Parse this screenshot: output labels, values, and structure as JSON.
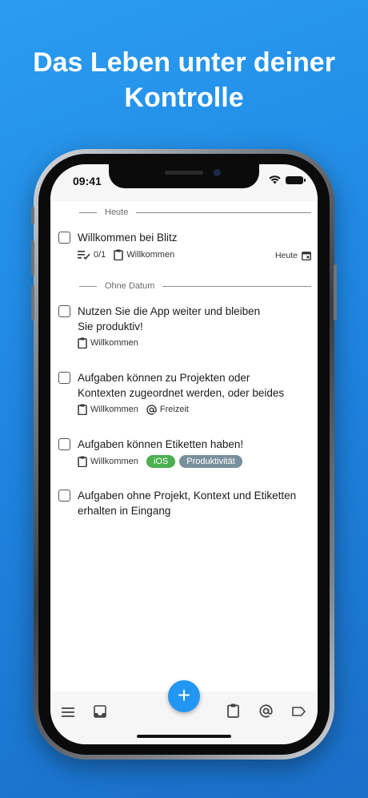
{
  "headline": {
    "line1": "Das Leben unter deiner",
    "line2": "Kontrolle"
  },
  "status_bar": {
    "time": "09:41"
  },
  "sections": [
    {
      "label": "Heute"
    },
    {
      "label": "Ohne Datum"
    }
  ],
  "tasks": [
    {
      "title_lines": [
        "Willkommen bei Blitz"
      ],
      "subtasks": "0/1",
      "project": "Willkommen",
      "due": "Heute"
    },
    {
      "title_lines": [
        "Nutzen Sie die App weiter und bleiben",
        "Sie produktiv!"
      ],
      "project": "Willkommen"
    },
    {
      "title_lines": [
        "Aufgaben können zu Projekten oder",
        "Kontexten zugeordnet werden, oder beides"
      ],
      "project": "Willkommen",
      "context": "Freizeit"
    },
    {
      "title_lines": [
        "Aufgaben können Etiketten haben!"
      ],
      "project": "Willkommen",
      "tags": [
        {
          "label": "iOS",
          "color": "#4caf50"
        },
        {
          "label": "Produktivität",
          "color": "#78909c"
        }
      ]
    },
    {
      "title_lines": [
        "Aufgaben ohne Projekt, Kontext und Etiketten",
        "erhalten in Eingang"
      ]
    }
  ],
  "fab": {
    "label": "+"
  },
  "tab_bar": {
    "icons": [
      "menu-icon",
      "inbox-icon",
      "clipboard-icon",
      "at-icon",
      "label-icon"
    ]
  },
  "colors": {
    "accent": "#2196f3",
    "background_gradient_start": "#2a9cf0",
    "background_gradient_end": "#1a6fc8"
  }
}
